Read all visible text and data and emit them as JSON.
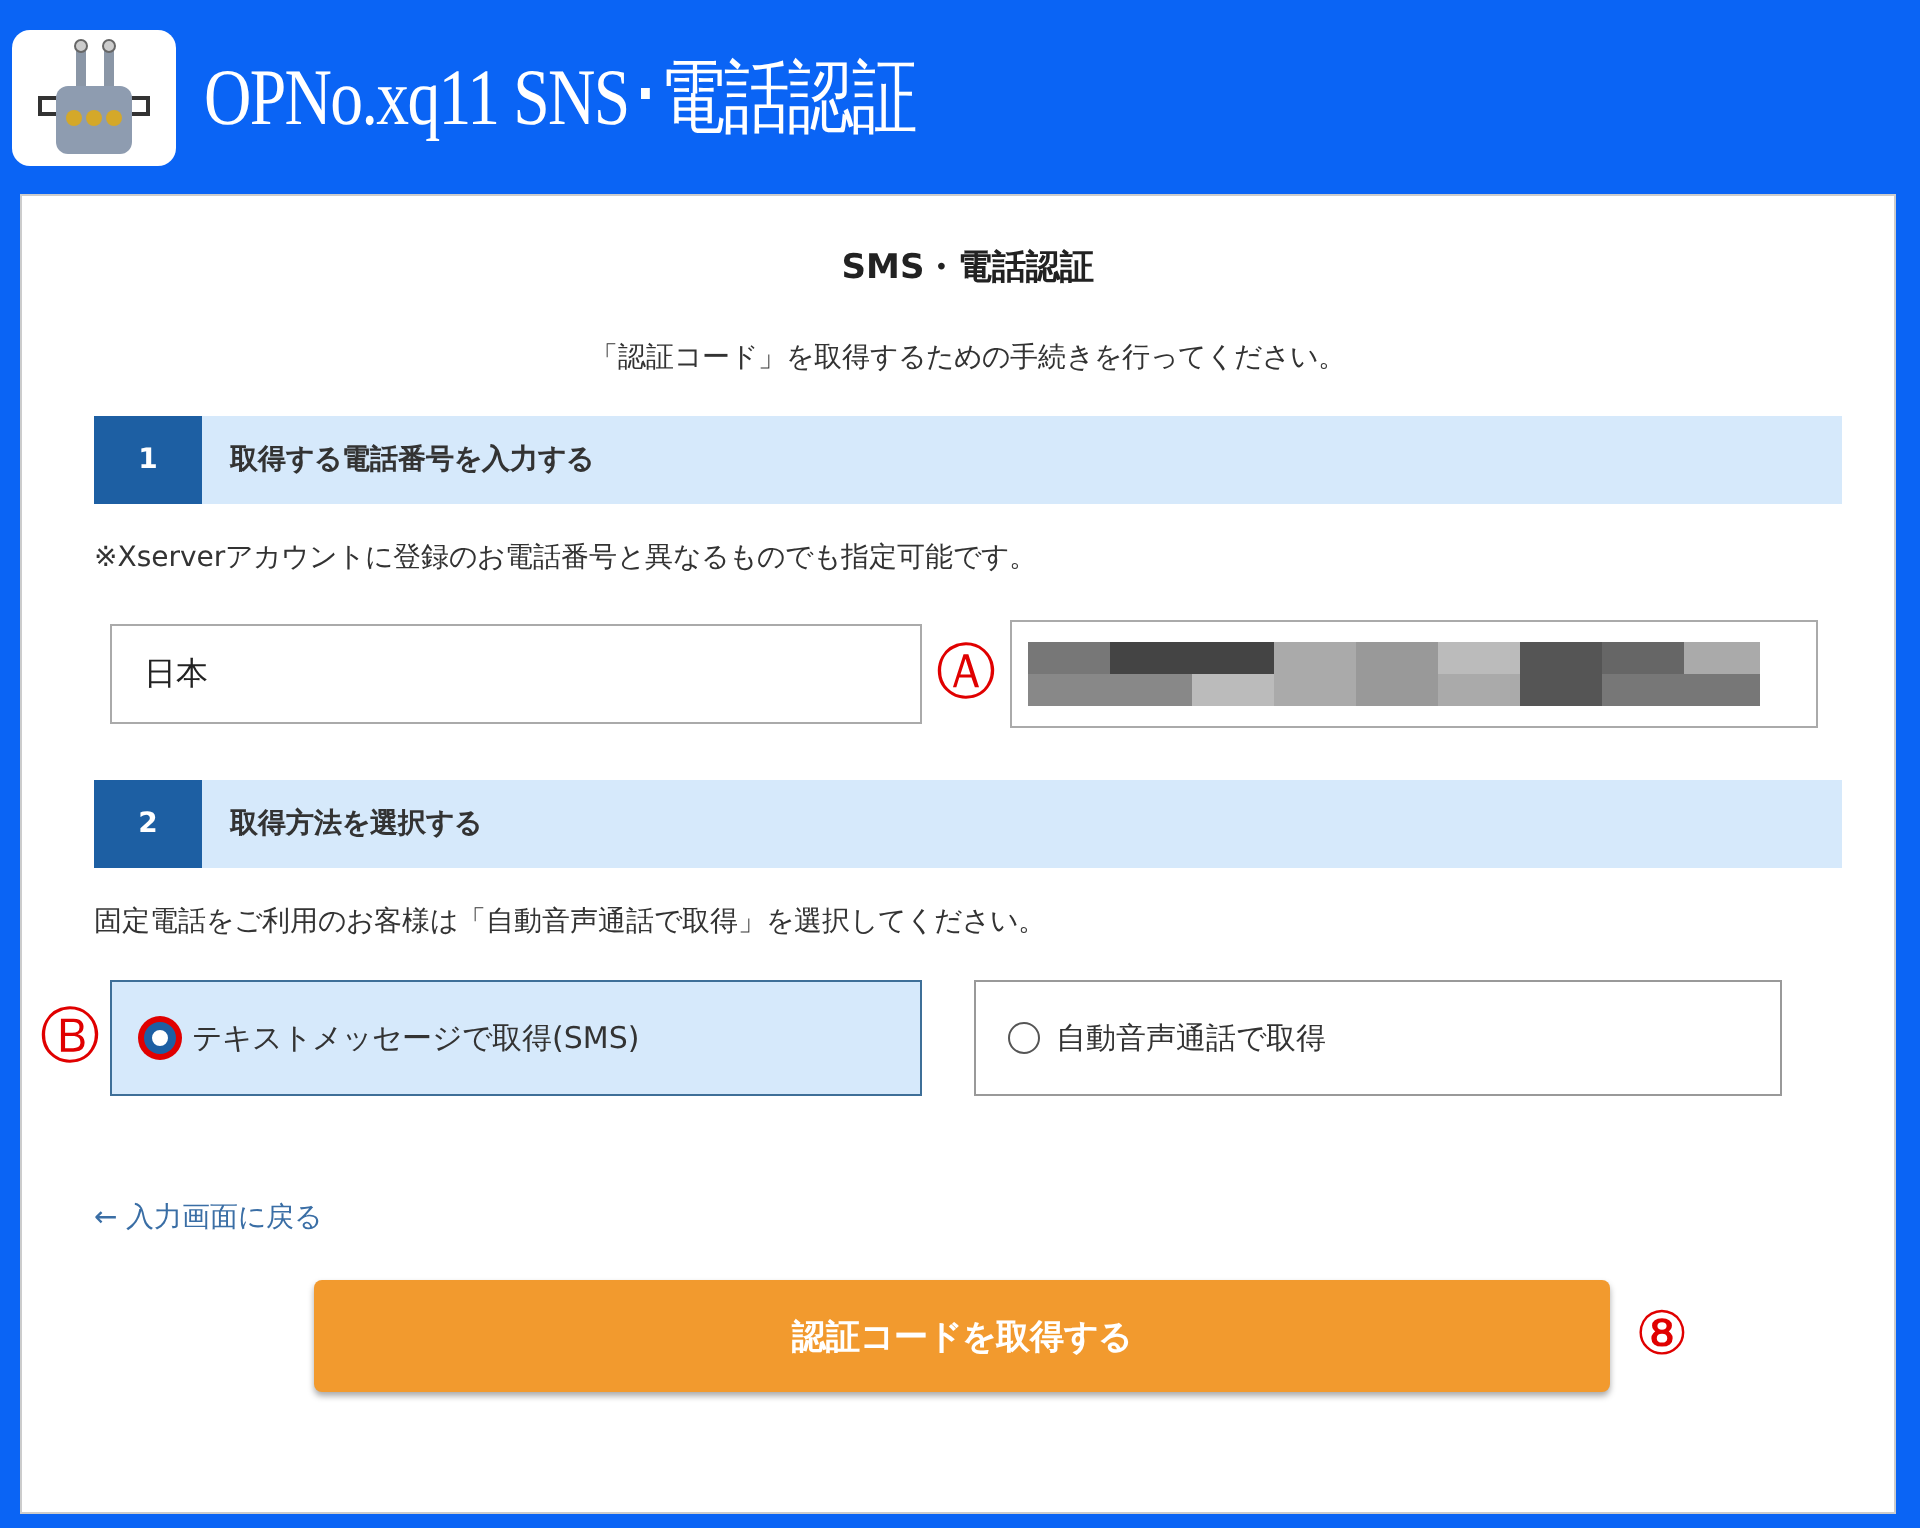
{
  "header": {
    "title": "OPNo.xq11 SNS･電話認証"
  },
  "form": {
    "title": "SMS・電話認証",
    "intro": "「認証コード」を取得するための手続きを行ってください。",
    "sections": [
      {
        "number": "1",
        "heading": "取得する電話番号を入力する",
        "note": "※Xserverアカウントに登録のお電話番号と異なるものでも指定可能です。"
      },
      {
        "number": "2",
        "heading": "取得方法を選択する",
        "note": "固定電話をご利用のお客様は「自動音声通話で取得」を選択してください。"
      }
    ],
    "country": {
      "value": "日本"
    },
    "methods": [
      {
        "label": "テキストメッセージで取得(SMS)",
        "selected": true
      },
      {
        "label": "自動音声通話で取得",
        "selected": false
      }
    ],
    "back_link": "← 入力画面に戻る",
    "submit": "認証コードを取得する"
  },
  "annotations": [
    {
      "mark": "Ⓐ"
    },
    {
      "mark": "Ⓑ"
    },
    {
      "mark": "⑧"
    }
  ]
}
